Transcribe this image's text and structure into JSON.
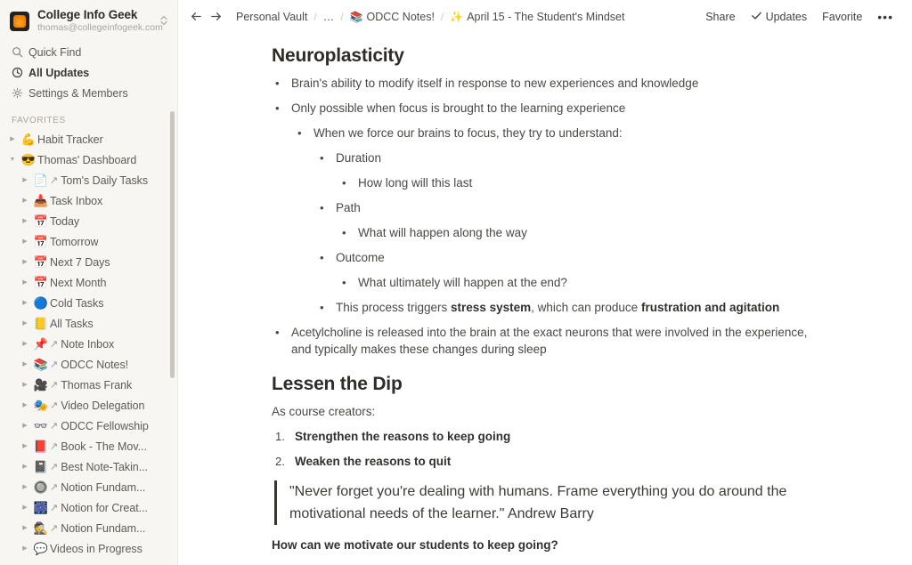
{
  "workspace": {
    "name": "College Info Geek",
    "email": "thomas@collegeinfogeek.com",
    "logo_icon": "workspace-logo-orange",
    "switcher_icon": "chevron-updown-icon"
  },
  "sidebar": {
    "nav": [
      {
        "label": "Quick Find",
        "icon": "search-icon",
        "bold": false
      },
      {
        "label": "All Updates",
        "icon": "clock-icon",
        "bold": true
      },
      {
        "label": "Settings & Members",
        "icon": "gear-icon",
        "bold": false
      }
    ],
    "favorites_title": "FAVORITES",
    "favorites": [
      {
        "label": "Habit Tracker",
        "emoji": "💪",
        "twisty": "collapsed",
        "level": 0,
        "link": false
      },
      {
        "label": "Thomas' Dashboard",
        "emoji": "😎",
        "twisty": "expanded",
        "level": 0,
        "link": false
      },
      {
        "label": "Tom's Daily Tasks",
        "emoji": "📄",
        "twisty": "collapsed",
        "level": 1,
        "link": true
      },
      {
        "label": "Task Inbox",
        "emoji": "📥",
        "twisty": "collapsed",
        "level": 1,
        "link": false
      },
      {
        "label": "Today",
        "emoji": "📅",
        "twisty": "collapsed",
        "level": 1,
        "link": false
      },
      {
        "label": "Tomorrow",
        "emoji": "📅",
        "twisty": "collapsed",
        "level": 1,
        "link": false
      },
      {
        "label": "Next 7 Days",
        "emoji": "📅",
        "twisty": "collapsed",
        "level": 1,
        "link": false
      },
      {
        "label": "Next Month",
        "emoji": "📅",
        "twisty": "collapsed",
        "level": 1,
        "link": false
      },
      {
        "label": "Cold Tasks",
        "emoji": "🔵",
        "twisty": "collapsed",
        "level": 1,
        "link": false
      },
      {
        "label": "All Tasks",
        "emoji": "📒",
        "twisty": "collapsed",
        "level": 1,
        "link": false
      },
      {
        "label": "Note Inbox",
        "emoji": "📌",
        "twisty": "collapsed",
        "level": 1,
        "link": true
      },
      {
        "label": "ODCC Notes!",
        "emoji": "📚",
        "twisty": "collapsed",
        "level": 1,
        "link": true
      },
      {
        "label": "Thomas Frank",
        "emoji": "🎥",
        "twisty": "collapsed",
        "level": 1,
        "link": true
      },
      {
        "label": "Video Delegation",
        "emoji": "🎭",
        "twisty": "collapsed",
        "level": 1,
        "link": true
      },
      {
        "label": "ODCC Fellowship",
        "emoji": "👓",
        "twisty": "collapsed",
        "level": 1,
        "link": true
      },
      {
        "label": "Book - The Mov...",
        "emoji": "📕",
        "twisty": "collapsed",
        "level": 1,
        "link": true
      },
      {
        "label": "Best Note-Takin...",
        "emoji": "📓",
        "twisty": "collapsed",
        "level": 1,
        "link": true
      },
      {
        "label": "Notion Fundam...",
        "emoji": "🔘",
        "twisty": "collapsed",
        "level": 1,
        "link": true
      },
      {
        "label": "Notion for Creat...",
        "emoji": "🎆",
        "twisty": "collapsed",
        "level": 1,
        "link": true
      },
      {
        "label": "Notion Fundam...",
        "emoji": "🕵️",
        "twisty": "collapsed",
        "level": 1,
        "link": true
      },
      {
        "label": "Videos in Progress",
        "emoji": "💬",
        "twisty": "collapsed",
        "level": 1,
        "link": false
      }
    ]
  },
  "topbar": {
    "back_icon": "arrow-left-icon",
    "forward_icon": "arrow-right-icon",
    "breadcrumbs": [
      {
        "label": "Personal Vault",
        "icon": ""
      },
      {
        "label": "…",
        "icon": ""
      },
      {
        "label": "ODCC Notes!",
        "icon": "📚"
      },
      {
        "label": "April 15 - The Student's Mindset",
        "icon": "✨"
      }
    ],
    "separator": "/",
    "share_label": "Share",
    "updates_label": "Updates",
    "updates_icon": "check-icon",
    "favorite_label": "Favorite",
    "more_icon": "more-dots-icon"
  },
  "document": {
    "heading1": "Neuroplasticity",
    "blocks": [
      {
        "depth": 1,
        "text": "Brain's ability to modify itself in response to new experiences and knowledge"
      },
      {
        "depth": 1,
        "text": "Only possible when focus is brought to the learning experience"
      },
      {
        "depth": 2,
        "text": "When we force our brains to focus, they try to understand:"
      },
      {
        "depth": 3,
        "text": "Duration"
      },
      {
        "depth": 4,
        "text": "How long will this last"
      },
      {
        "depth": 3,
        "text": "Path"
      },
      {
        "depth": 4,
        "text": "What will happen along the way"
      },
      {
        "depth": 3,
        "text": "Outcome"
      },
      {
        "depth": 4,
        "text": "What ultimately will happen at the end?"
      },
      {
        "depth": 3,
        "html": "This process triggers <b>stress system</b>, which can produce <b>frustration and agitation</b>"
      },
      {
        "depth": 1,
        "text": "Acetylcholine is released into the brain at the exact neurons that were involved in the experience, and typically makes these changes during sleep"
      }
    ],
    "heading2": "Lessen the Dip",
    "lead_text": "As course creators:",
    "numbered": [
      {
        "num": "1.",
        "text": "Strengthen the reasons to keep going"
      },
      {
        "num": "2.",
        "text": "Weaken the reasons to quit"
      }
    ],
    "quote": "\"Never forget you're dealing with humans. Frame everything you do around the motivational needs of the learner.\" Andrew Barry",
    "closing_question": "How can we motivate our students to keep going?",
    "bullet_glyph": "•"
  },
  "colors": {
    "sidebar_bg": "#f7f6f3",
    "text": "#4b4742",
    "heading": "#2f2c28",
    "accent": "#f08400"
  }
}
